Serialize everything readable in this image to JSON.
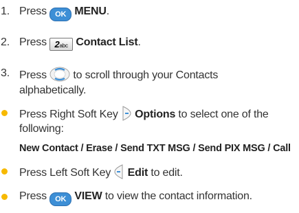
{
  "steps": [
    {
      "number": "1.",
      "pre": "Press",
      "key": "OK",
      "label": "MENU",
      "post": "."
    },
    {
      "number": "2.",
      "pre": "Press",
      "key_digit": "2",
      "key_letters": "abc",
      "label": "Contact List",
      "post": "."
    },
    {
      "number": "3.",
      "pre": "Press",
      "post": "to scroll through your Contacts",
      "post_line2": "alphabetically."
    }
  ],
  "bullets": [
    {
      "pre": "Press Right Soft Key",
      "label": "Options",
      "post": "to select one of the",
      "post_line2": "following:",
      "options": "New Contact / Erase / Send TXT MSG / Send PIX MSG / Call"
    },
    {
      "pre": "Press Left Soft Key",
      "label": "Edit",
      "post": "to edit."
    },
    {
      "pre": "Press",
      "key": "OK",
      "label": "VIEW",
      "post": "to view the contact information."
    }
  ],
  "colors": {
    "bullet": "#f7b900",
    "ok_key": "#3d8fd6"
  }
}
